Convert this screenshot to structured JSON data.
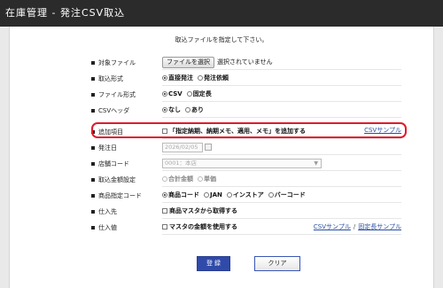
{
  "header": {
    "title": "在庫管理 - 発注CSV取込"
  },
  "instruction": "取込ファイルを指定して下さい。",
  "rows": {
    "file": {
      "label": "対象ファイル",
      "button": "ファイルを選択",
      "status": "選択されていません"
    },
    "mode": {
      "label": "取込形式",
      "opt1": "直接発注",
      "opt2": "発注依頼",
      "selected": "直接発注"
    },
    "format": {
      "label": "ファイル形式",
      "opt1": "CSV",
      "opt2": "固定長",
      "selected": "CSV"
    },
    "header": {
      "label": "CSVヘッダ",
      "opt1": "なし",
      "opt2": "あり",
      "selected": "なし"
    },
    "extra": {
      "label": "追加項目",
      "checkbox": "「指定納期、納期メモ、適用、メモ」を追加する",
      "link": "CSVサンプル"
    },
    "order_date": {
      "label": "発注日",
      "value": "2026/02/05"
    },
    "store": {
      "label": "店舗コード",
      "value": "0001：本店"
    },
    "amount": {
      "label": "取込金額設定",
      "opt1": "合計金額",
      "opt2": "単価"
    },
    "product_code": {
      "label": "商品指定コード",
      "opt1": "商品コード",
      "opt2": "JAN",
      "opt3": "インストア",
      "opt4": "バーコード",
      "selected": "商品コード"
    },
    "supplier": {
      "label": "仕入先",
      "checkbox": "商品マスタから取得する"
    },
    "cost": {
      "label": "仕入値",
      "checkbox": "マスタの金額を使用する",
      "link1": "CSVサンプル",
      "separator": "/",
      "link2": "固定長サンプル"
    }
  },
  "actions": {
    "submit": "登 録",
    "clear": "クリア"
  },
  "colors": {
    "highlight": "#e01b2b",
    "primary": "#2f4aa8",
    "titlebar": "#2b2b2b"
  }
}
